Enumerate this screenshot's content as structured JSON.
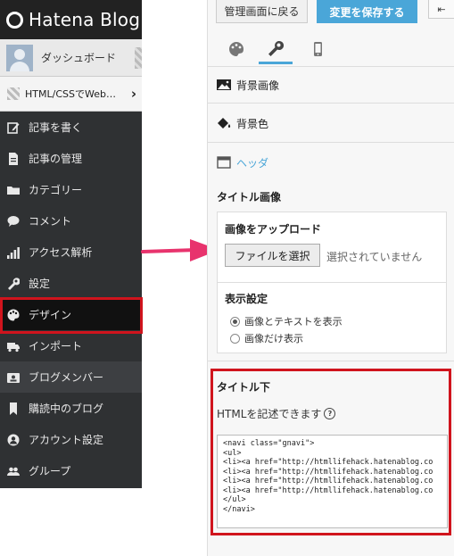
{
  "app": {
    "logo_text": "Hatena Blog"
  },
  "sidebar": {
    "dashboard_label": "ダッシュボード",
    "blog_name": "HTML/CSSでWeb…",
    "items": [
      {
        "label": "記事を書く",
        "icon": "pencil-icon"
      },
      {
        "label": "記事の管理",
        "icon": "document-icon"
      },
      {
        "label": "カテゴリー",
        "icon": "folder-icon"
      },
      {
        "label": "コメント",
        "icon": "comment-icon"
      },
      {
        "label": "アクセス解析",
        "icon": "bar-chart-icon"
      },
      {
        "label": "設定",
        "icon": "wrench-icon"
      },
      {
        "label": "デザイン",
        "icon": "palette-icon"
      },
      {
        "label": "インポート",
        "icon": "truck-icon"
      },
      {
        "label": "ブログメンバー",
        "icon": "id-card-icon"
      },
      {
        "label": "購読中のブログ",
        "icon": "bookmark-icon"
      },
      {
        "label": "アカウント設定",
        "icon": "user-circle-icon"
      },
      {
        "label": "グループ",
        "icon": "group-icon"
      }
    ],
    "active_item": "デザイン"
  },
  "toolbar": {
    "back_label": "管理画面に戻る",
    "save_label": "変更を保存する",
    "collapse_icon": "collapse-arrow-icon"
  },
  "tabs": [
    {
      "name": "palette",
      "icon": "palette-icon",
      "active": false
    },
    {
      "name": "customize",
      "icon": "wrench-icon",
      "active": true
    },
    {
      "name": "smartphone",
      "icon": "smartphone-icon",
      "active": false
    }
  ],
  "sections": {
    "background_image": "背景画像",
    "background_color": "背景色",
    "header": "ヘッダ"
  },
  "title_image": {
    "heading": "タイトル画像",
    "upload_label": "画像をアップロード",
    "file_button": "ファイルを選択",
    "no_file": "選択されていません",
    "display_heading": "表示設定",
    "options": [
      {
        "label": "画像とテキストを表示",
        "checked": true
      },
      {
        "label": "画像だけ表示",
        "checked": false
      }
    ]
  },
  "title_below": {
    "heading": "タイトル下",
    "hint": "HTMLを記述できます",
    "code": "<navi class=\"gnavi\">\n<ul>\n<li><a href=\"http://htmllifehack.hatenablog.co\n<li><a href=\"http://htmllifehack.hatenablog.co\n<li><a href=\"http://htmllifehack.hatenablog.co\n<li><a href=\"http://htmllifehack.hatenablog.co\n</ul>\n</navi>"
  },
  "colors": {
    "accent": "#4aa6d8",
    "highlight": "#d0141d",
    "arrow": "#e8336d",
    "sidebar_bg": "#2f3133"
  }
}
